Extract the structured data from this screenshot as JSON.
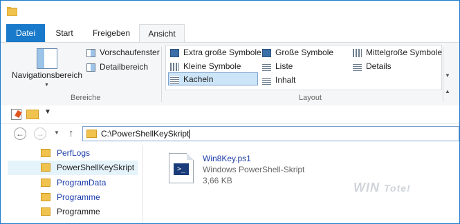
{
  "ribbon": {
    "tabs": [
      "Datei",
      "Start",
      "Freigeben",
      "Ansicht"
    ],
    "active_tab": "Ansicht",
    "bereiche": {
      "label": "Bereiche",
      "navigationsbereich": "Navigationsbereich",
      "vorschaufenster": "Vorschaufenster",
      "detailbereich": "Detailbereich"
    },
    "layout": {
      "label": "Layout",
      "items": [
        "Extra große Symbole",
        "Große Symbole",
        "Mittelgroße Symbole",
        "Kleine Symbole",
        "Liste",
        "Details",
        "Kacheln",
        "Inhalt"
      ],
      "selected": "Kacheln"
    }
  },
  "address": {
    "path": "C:\\PowerShellKeySkript"
  },
  "nav_pane": {
    "items": [
      {
        "label": "PerfLogs",
        "color": "#1a3aa8"
      },
      {
        "label": "PowerShellKeySkript",
        "color": "#222222",
        "selected": true
      },
      {
        "label": "ProgramData",
        "color": "#1a3aa8"
      },
      {
        "label": "Programme",
        "color": "#1a3aa8"
      },
      {
        "label": "Programme",
        "color": "#222222"
      }
    ]
  },
  "content": {
    "file": {
      "name": "Win8Key.ps1",
      "type": "Windows PowerShell-Skript",
      "size": "3,66 KB",
      "icon": "powershell-script-icon"
    }
  },
  "watermark": {
    "text_a": "WIN",
    "text_b": "Tote!"
  }
}
